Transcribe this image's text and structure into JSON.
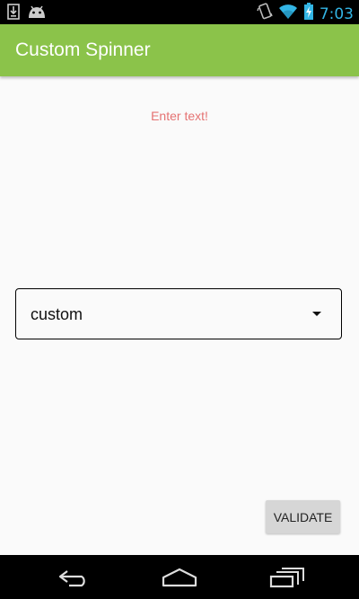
{
  "status_bar": {
    "time": "7:03",
    "icons": [
      "download-icon",
      "android-icon",
      "vibrate-icon",
      "wifi-icon",
      "battery-icon"
    ]
  },
  "app_bar": {
    "title": "Custom Spinner",
    "color": "#8bc34a"
  },
  "main": {
    "hint_text": "Enter text!",
    "hint_color": "#e57373",
    "spinner": {
      "selected_value": "custom"
    },
    "validate_button": {
      "label": "VALIDATE"
    }
  },
  "nav_bar": {
    "buttons": [
      "back-icon",
      "home-icon",
      "recents-icon"
    ]
  },
  "colors": {
    "accent_time": "#33b5e5",
    "background": "#fafafa"
  }
}
